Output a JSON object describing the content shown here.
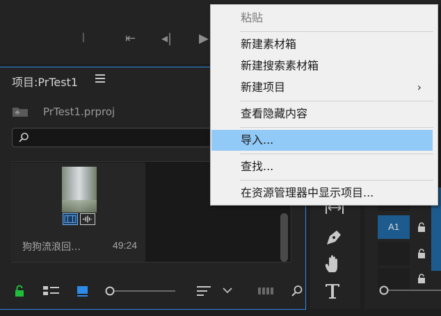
{
  "transport": {
    "buttons": [
      {
        "name": "mark-out-icon",
        "glyph": "⦚"
      },
      {
        "name": "go-to-in-icon",
        "glyph": "⇤"
      },
      {
        "name": "step-back-icon",
        "glyph": "◂|"
      },
      {
        "name": "play-icon",
        "glyph": "▶"
      }
    ]
  },
  "project": {
    "title": "项目:PrTest1",
    "file_name": "PrTest1.prproj",
    "search_placeholder": "",
    "clip": {
      "name": "狗狗流浪回…",
      "duration": "49:24"
    }
  },
  "tools": {
    "items": [
      {
        "name": "pen-tool-icon",
        "glyph": "✒"
      },
      {
        "name": "hand-tool-icon",
        "glyph": "✋"
      },
      {
        "name": "type-tool-icon",
        "glyph": "T"
      }
    ]
  },
  "timeline": {
    "track_label": "A1"
  },
  "context_menu": {
    "items": [
      {
        "label": "粘贴",
        "disabled": true
      },
      {
        "label": "新建素材箱"
      },
      {
        "label": "新建搜索素材箱"
      },
      {
        "label": "新建项目",
        "submenu": true
      },
      {
        "label": "查看隐藏内容"
      },
      {
        "label": "导入...",
        "highlighted": true
      },
      {
        "label": "查找..."
      },
      {
        "label": "在资源管理器中显示项目..."
      }
    ],
    "submenu_arrow": "›"
  },
  "colors": {
    "accent": "#2d8ceb",
    "menu_highlight": "#91c9f7",
    "lock_green": "#1fbf3a",
    "track_blue": "#1d5b8e"
  }
}
